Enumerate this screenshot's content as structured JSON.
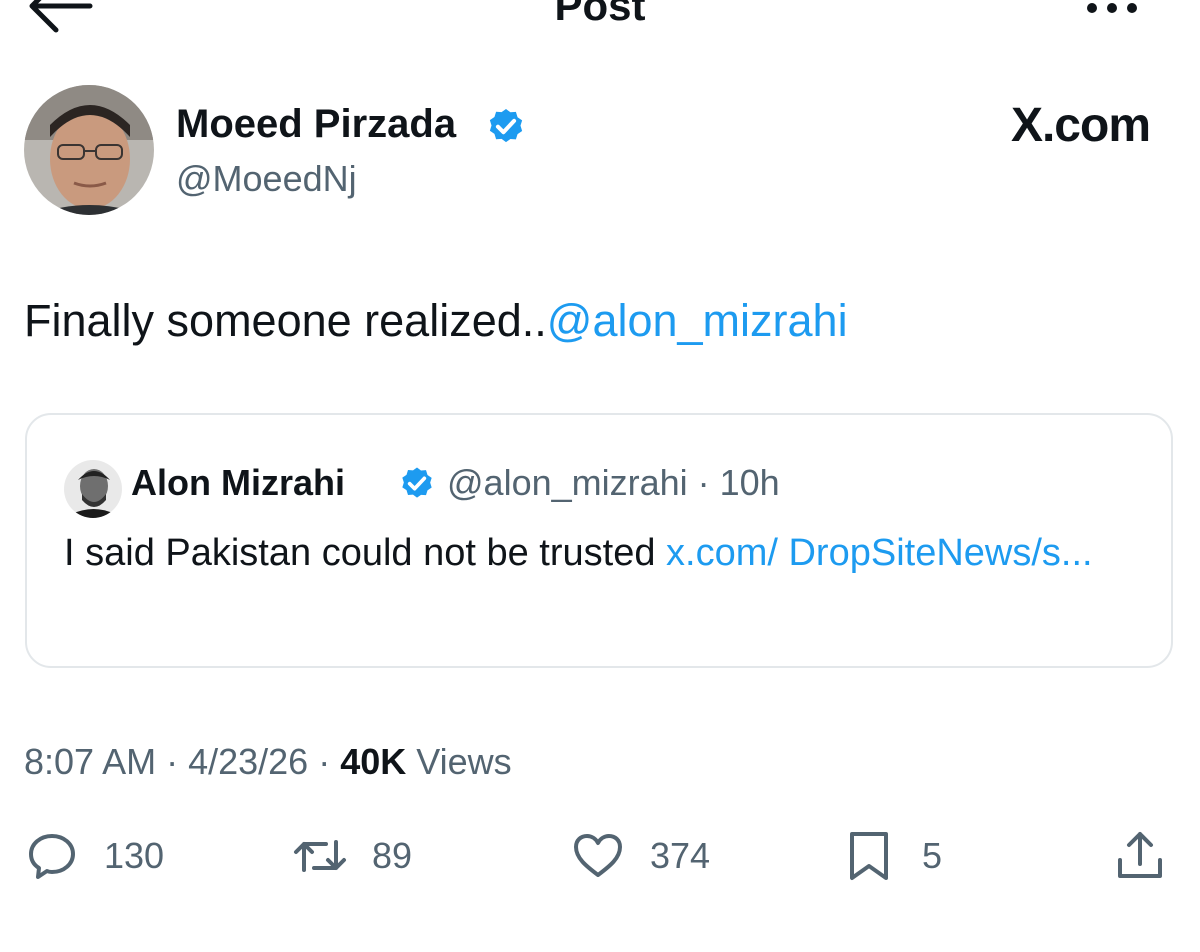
{
  "header": {
    "title": "Post"
  },
  "author": {
    "name": "Moeed Pirzada",
    "handle": "@MoeedNj",
    "verified": true
  },
  "brand": "X.com",
  "post": {
    "text": "Finally someone realized..",
    "mention": "@alon_mizrahi"
  },
  "quote": {
    "name": "Alon Mizrahi",
    "meta": "@alon_mizrahi · 10h",
    "text": "I said Pakistan could not be trusted ",
    "link": "x.com/ DropSiteNews/s..."
  },
  "timestamp": {
    "time_date": "8:07 AM · 4/23/26 · ",
    "views_count": "40K",
    "views_label": " Views"
  },
  "actions": {
    "replies": "130",
    "reposts": "89",
    "likes": "374",
    "bookmarks": "5"
  },
  "colors": {
    "accent": "#1d9bf0",
    "text": "#0f1419",
    "secondary": "#536471",
    "border": "#e3e7ea"
  },
  "icons": {
    "back": "arrow-left-icon",
    "more": "more-horizontal-icon",
    "verified": "verified-badge-icon",
    "reply": "reply-icon",
    "repost": "repost-icon",
    "like": "heart-icon",
    "bookmark": "bookmark-icon",
    "share": "share-icon"
  }
}
